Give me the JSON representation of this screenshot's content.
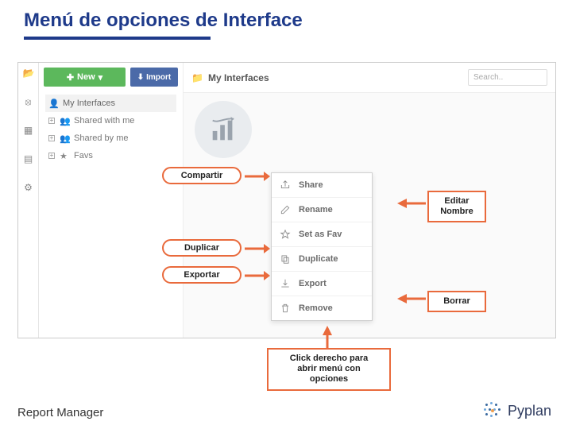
{
  "title": "Menú de opciones de Interface",
  "footer": {
    "left": "Report Manager",
    "brand": "Pyplan"
  },
  "sidebar": {
    "new_label": "New",
    "import_label": "Import",
    "items": [
      {
        "label": "My Interfaces"
      },
      {
        "label": "Shared with me"
      },
      {
        "label": "Shared by me"
      },
      {
        "label": "Favs"
      }
    ]
  },
  "header": {
    "title": "My Interfaces",
    "search_placeholder": "Search.."
  },
  "context_menu": {
    "items": [
      {
        "label": "Share"
      },
      {
        "label": "Rename"
      },
      {
        "label": "Set as Fav"
      },
      {
        "label": "Duplicate"
      },
      {
        "label": "Export"
      },
      {
        "label": "Remove"
      }
    ]
  },
  "callouts": {
    "compartir": "Compartir",
    "editar_nombre": "Editar\nNombre",
    "duplicar": "Duplicar",
    "exportar": "Exportar",
    "borrar": "Borrar",
    "click_derecho": "Click derecho para\nabrir menú con\nopciones"
  }
}
